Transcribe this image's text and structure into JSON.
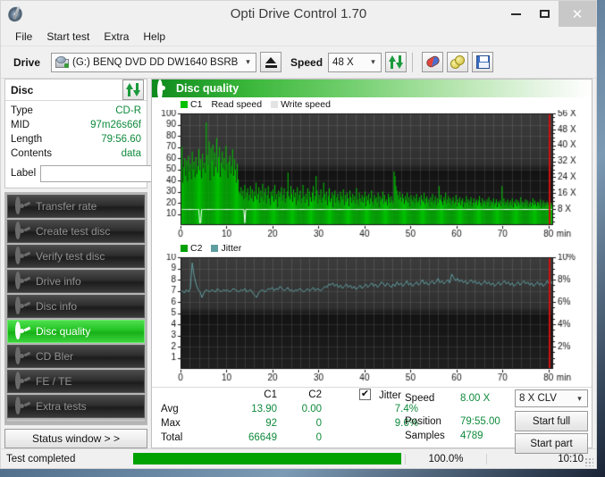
{
  "window": {
    "title": "Opti Drive Control 1.70",
    "app_icon": "disc-pen-icon",
    "minimize": "–",
    "maximize": "□",
    "close": "✕"
  },
  "menubar": {
    "items": [
      "File",
      "Start test",
      "Extra",
      "Help"
    ]
  },
  "toolbar": {
    "drive_label": "Drive",
    "drive_value": "(G:)   BENQ DVD DD DW1640 BSRB",
    "eject_title": "Eject",
    "speed_label": "Speed",
    "speed_value": "48 X",
    "refresh_icon": "refresh-icon",
    "erase_icon": "erase-disc-icon",
    "bitsetting_icon": "bitsetting-icon",
    "save_icon": "save-icon"
  },
  "disc_panel": {
    "title": "Disc",
    "refresh_icon": "refresh-icon",
    "rows": [
      {
        "key": "Type",
        "value": "CD-R"
      },
      {
        "key": "MID",
        "value": "97m26s66f"
      },
      {
        "key": "Length",
        "value": "79:56.60"
      },
      {
        "key": "Contents",
        "value": "data"
      }
    ],
    "label_key": "Label",
    "label_value": "",
    "label_placeholder": "",
    "cd_button_icon": "cd-disc-icon"
  },
  "sidebar": {
    "items": [
      {
        "label": "Transfer rate",
        "icon": "disc-icon",
        "active": false
      },
      {
        "label": "Create test disc",
        "icon": "disc-icon",
        "active": false
      },
      {
        "label": "Verify test disc",
        "icon": "disc-icon",
        "active": false
      },
      {
        "label": "Drive info",
        "icon": "disc-icon",
        "active": false
      },
      {
        "label": "Disc info",
        "icon": "disc-icon",
        "active": false
      },
      {
        "label": "Disc quality",
        "icon": "disc-icon",
        "active": true
      },
      {
        "label": "CD Bler",
        "icon": "disc-icon",
        "active": false
      },
      {
        "label": "FE / TE",
        "icon": "disc-icon",
        "active": false
      },
      {
        "label": "Extra tests",
        "icon": "disc-icon",
        "active": false
      }
    ],
    "status_window_button": "Status window > >"
  },
  "main": {
    "header_title": "Disc quality",
    "header_icon": "disc-icon"
  },
  "stats": {
    "headers": [
      "",
      "C1",
      "C2"
    ],
    "rows": [
      {
        "key": "Avg",
        "c1": "13.90",
        "c2": "0.00",
        "jitter": "7.4%"
      },
      {
        "key": "Max",
        "c1": "92",
        "c2": "0",
        "jitter": "9.6%"
      },
      {
        "key": "Total",
        "c1": "66649",
        "c2": "0",
        "jitter": ""
      }
    ],
    "jitter_label": "Jitter",
    "jitter_checked": true,
    "jitter_check_glyph": "✔",
    "speed_label": "Speed",
    "speed_value": "8.00 X",
    "position_label": "Position",
    "position_value": "79:55.00",
    "samples_label": "Samples",
    "samples_value": "4789",
    "clv_value": "8 X CLV",
    "start_full_label": "Start full",
    "start_part_label": "Start part"
  },
  "statusbar": {
    "message": "Test completed",
    "progress_percent": "100.0%",
    "progress_value": 100,
    "elapsed": "10:10"
  },
  "colors": {
    "accent_green": "#22c322",
    "value_green": "#0f8a3c",
    "c1_green": "#00c000",
    "jitter_teal": "#5f9ea0",
    "plot_bg": "#1e1e1e",
    "end_marker_red": "#d01010"
  },
  "chart_data": [
    {
      "type": "area",
      "name": "c1-read-speed-chart",
      "title": "Disc quality",
      "legend": [
        {
          "label": "C1",
          "color": "#00c000",
          "swatch": true
        },
        {
          "label": "Read speed",
          "color": "#ffffff",
          "swatch": false
        },
        {
          "label": "Write speed",
          "color": "#e0e0e0",
          "swatch": true
        }
      ],
      "xlabel": "min",
      "ylabel": "",
      "xlim": [
        0,
        81
      ],
      "ylim": [
        0,
        100
      ],
      "xticks": [
        0,
        10,
        20,
        30,
        40,
        50,
        60,
        70,
        80
      ],
      "yticks": [
        10,
        20,
        30,
        40,
        50,
        60,
        70,
        80,
        90,
        100
      ],
      "y2label": "X",
      "y2ticks": [
        "8 X",
        "16 X",
        "24 X",
        "32 X",
        "40 X",
        "48 X",
        "56 X"
      ],
      "y2lim": [
        0,
        56
      ],
      "grid": true,
      "series": [
        {
          "name": "C1",
          "color": "#00c000",
          "values": [
            45,
            70,
            38,
            52,
            60,
            44,
            58,
            39,
            62,
            48,
            55,
            41,
            66,
            50,
            57,
            43,
            61,
            46,
            53,
            68,
            49,
            59,
            42,
            64,
            51,
            56,
            47,
            92,
            63,
            54,
            75,
            40,
            69,
            58,
            72,
            44,
            65,
            52,
            78,
            47,
            61,
            70,
            43,
            56,
            66,
            51,
            60,
            49,
            71,
            55,
            42,
            57,
            62,
            46,
            53,
            68,
            44,
            59,
            50,
            38,
            55,
            41,
            30,
            28,
            34,
            26,
            31,
            23,
            36,
            25,
            29,
            33,
            22,
            27,
            35,
            24,
            32,
            21,
            30,
            26,
            38,
            23,
            28,
            34,
            20,
            31,
            25,
            37,
            22,
            29,
            33,
            19,
            27,
            35,
            24,
            18,
            30,
            26,
            32,
            21,
            36,
            23,
            28,
            16,
            31,
            25,
            29,
            34,
            22,
            27,
            33,
            20,
            24,
            30,
            47,
            26,
            23,
            35,
            28,
            21,
            32,
            25,
            29,
            18,
            34,
            22,
            27,
            31,
            19,
            24,
            36,
            26,
            20,
            28,
            23,
            33,
            17,
            30,
            25,
            21,
            29,
            35,
            22,
            26,
            44,
            31,
            19,
            27,
            23,
            32,
            20,
            25,
            38,
            28,
            22,
            30,
            18,
            26,
            33,
            21,
            24,
            29,
            16,
            27,
            31,
            20,
            25,
            28,
            22,
            19,
            30,
            26,
            23,
            32,
            18,
            27,
            21,
            29,
            24,
            17,
            31,
            25,
            20,
            28,
            22,
            26,
            19,
            33,
            23,
            18,
            29,
            24,
            21,
            27,
            20,
            25,
            30,
            17,
            26,
            22,
            28,
            19,
            24,
            31,
            21,
            18,
            27,
            23,
            25,
            20,
            29,
            16,
            26,
            22,
            24,
            30,
            19,
            27,
            21,
            23,
            18,
            28,
            25,
            20,
            26,
            22,
            19,
            48,
            44,
            35,
            31,
            27,
            23,
            30,
            25,
            21,
            28,
            24,
            19,
            26,
            22,
            29,
            20,
            25,
            17,
            27,
            23,
            21,
            26,
            19,
            24,
            28,
            20,
            22,
            25,
            18,
            27,
            23,
            21,
            29,
            19,
            24,
            26,
            20,
            23,
            17,
            25,
            21,
            28,
            19,
            22,
            26,
            18,
            24,
            20,
            35,
            23,
            27,
            21,
            18,
            25,
            22,
            29,
            19,
            23,
            26,
            20,
            24,
            18,
            22,
            25,
            19,
            21,
            27,
            17,
            23,
            20,
            25,
            18,
            22,
            24,
            16,
            21,
            19,
            26,
            20,
            23,
            18,
            22,
            25,
            17,
            20,
            24,
            19,
            21,
            23,
            18,
            22,
            26,
            20,
            17,
            24,
            19,
            22,
            21,
            18,
            23,
            20,
            25,
            17,
            22,
            19,
            21,
            24,
            18,
            20,
            23,
            16,
            21,
            19,
            22,
            17,
            35,
            20,
            24,
            18,
            21,
            19,
            23,
            17,
            20,
            22,
            18,
            24,
            16,
            21,
            19,
            23,
            17,
            22,
            20,
            18,
            25,
            19,
            21,
            17,
            20,
            23,
            18,
            22,
            16,
            19,
            21,
            17,
            20,
            24,
            18,
            22,
            19,
            17,
            21,
            20,
            18,
            23,
            16,
            19,
            22,
            17,
            20,
            18,
            21,
            19,
            17,
            23,
            20,
            18,
            22
          ]
        },
        {
          "name": "Read speed",
          "color": "#ffffff",
          "note": "flat white line at ~14 on left scale (8X), with two dropouts near 4 min and 14 min",
          "value_constant": 14
        }
      ],
      "end_marker_x": 80.3
    },
    {
      "type": "line",
      "name": "c2-jitter-chart",
      "legend": [
        {
          "label": "C2",
          "color": "#00a000",
          "swatch": true
        },
        {
          "label": "Jitter",
          "color": "#5f9ea0",
          "swatch": true
        }
      ],
      "xlabel": "min",
      "xlim": [
        0,
        81
      ],
      "ylim": [
        0,
        10
      ],
      "xticks": [
        0,
        10,
        20,
        30,
        40,
        50,
        60,
        70,
        80
      ],
      "yticks": [
        1,
        2,
        3,
        4,
        5,
        6,
        7,
        8,
        9,
        10
      ],
      "y2ticks": [
        "2%",
        "4%",
        "6%",
        "8%",
        "10%"
      ],
      "y2lim": [
        0,
        10
      ],
      "grid": true,
      "series": [
        {
          "name": "Jitter",
          "color": "#5f9ea0",
          "values": [
            6.9,
            7.0,
            6.8,
            7.1,
            6.9,
            7.2,
            9.5,
            8.3,
            7.6,
            7.1,
            6.9,
            6.4,
            6.8,
            7.1,
            7.0,
            6.9,
            7.1,
            7.0,
            6.9,
            7.2,
            7.0,
            6.9,
            7.1,
            7.0,
            7.1,
            6.9,
            7.0,
            7.2,
            7.1,
            7.0,
            6.9,
            7.1,
            7.0,
            7.2,
            6.9,
            7.0,
            7.1,
            6.8,
            6.6,
            6.4,
            6.8,
            7.0,
            7.1,
            6.9,
            7.0,
            7.2,
            7.1,
            7.3,
            7.0,
            7.2,
            7.1,
            7.4,
            7.2,
            7.0,
            7.1,
            7.3,
            7.0,
            7.1,
            6.9,
            7.1,
            7.0,
            7.2,
            7.1,
            6.9,
            7.0,
            7.2,
            7.0,
            7.1,
            7.3,
            7.0,
            7.2,
            7.1,
            7.0,
            7.2,
            7.4,
            7.3,
            7.6,
            7.5,
            7.7,
            7.4,
            7.6,
            7.3,
            7.5,
            7.2,
            7.4,
            7.6,
            7.3,
            7.5,
            7.2,
            7.4,
            7.1,
            7.3,
            7.5,
            7.2,
            7.4,
            7.6,
            7.3,
            7.5,
            7.7,
            7.4,
            7.6,
            7.3,
            7.5,
            7.8,
            7.6,
            7.4,
            7.7,
            7.5,
            7.3,
            7.6,
            7.4,
            7.8,
            7.5,
            7.7,
            7.4,
            7.6,
            7.9,
            7.5,
            7.7,
            7.4,
            7.6,
            7.8,
            7.5,
            7.7,
            8.0,
            7.6,
            7.8,
            7.5,
            7.7,
            7.9,
            7.6,
            7.8,
            8.1,
            7.7,
            7.9,
            7.6,
            7.8,
            8.0,
            7.7,
            8.5,
            8.2,
            7.9,
            8.1,
            7.8,
            8.0,
            7.7,
            7.9,
            7.6,
            7.8,
            8.0,
            7.7,
            7.9,
            7.6,
            7.8,
            7.5,
            7.7,
            7.9,
            7.6,
            7.8,
            7.5,
            7.7,
            7.4,
            7.6,
            7.8,
            7.5,
            7.7,
            7.9,
            7.6,
            7.8,
            7.5,
            7.7,
            7.4,
            7.6,
            7.8,
            7.5,
            7.7,
            7.9,
            7.6,
            7.8,
            7.5,
            7.7,
            7.4,
            7.6,
            7.8,
            7.5,
            7.7,
            7.4,
            7.6,
            7.9,
            7.6,
            7.8,
            7.5
          ]
        },
        {
          "name": "C2",
          "color": "#00a000",
          "values": []
        }
      ],
      "end_marker_x": 80.3
    }
  ]
}
